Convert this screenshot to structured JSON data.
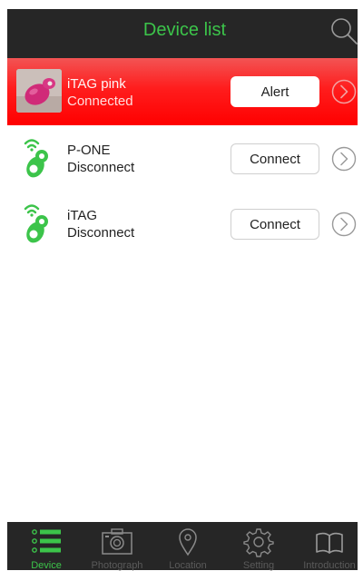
{
  "header": {
    "title": "Device list",
    "icon": "search-icon"
  },
  "devices": [
    {
      "name": "iTAG pink",
      "status": "Connected",
      "action": "Alert",
      "alarm": true
    },
    {
      "name": "P-ONE",
      "status": "Disconnect",
      "action": "Connect",
      "alarm": false
    },
    {
      "name": "iTAG",
      "status": "Disconnect",
      "action": "Connect",
      "alarm": false
    }
  ],
  "tabs": [
    {
      "label": "Device",
      "icon": "list-icon",
      "active": true
    },
    {
      "label": "Photograph",
      "icon": "camera-icon",
      "active": false
    },
    {
      "label": "Location",
      "icon": "location-pin-icon",
      "active": false
    },
    {
      "label": "Setting",
      "icon": "gear-icon",
      "active": false
    },
    {
      "label": "Introduction",
      "icon": "book-icon",
      "active": false
    }
  ],
  "colors": {
    "accent": "#3cc44a",
    "header_bg": "#262626",
    "alarm_red": "#ff1d1d"
  }
}
